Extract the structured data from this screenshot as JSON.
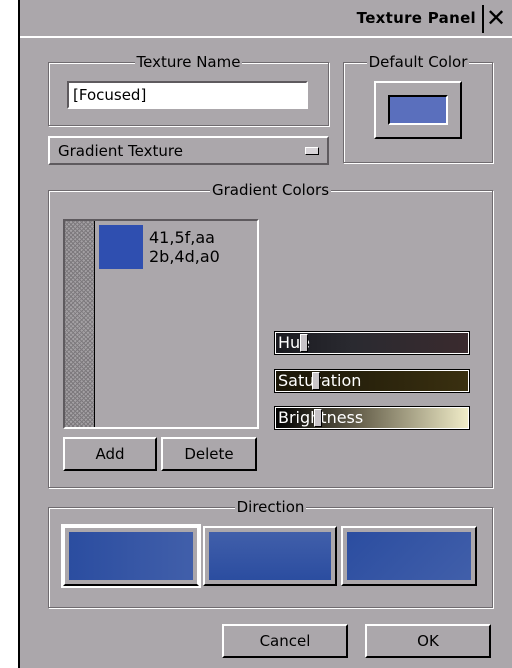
{
  "window": {
    "title": "Texture Panel",
    "close_glyph": "✕"
  },
  "texture_name": {
    "legend": "Texture Name",
    "value": "[Focused]"
  },
  "default_color": {
    "legend": "Default Color",
    "color": "#5a6fbd"
  },
  "texture_type": {
    "selected": "Gradient Texture"
  },
  "gradient_colors": {
    "legend": "Gradient Colors",
    "items": [
      {
        "swatch": "#2f4fb0",
        "line1": "41,5f,aa",
        "line2": "2b,4d,a0"
      }
    ],
    "add_label": "Add",
    "delete_label": "Delete",
    "sliders": {
      "hue": {
        "label": "Hue",
        "value": 0.15
      },
      "saturation": {
        "label": "Saturation",
        "value": 0.2
      },
      "brightness": {
        "label": "Brightness",
        "value": 0.22
      }
    }
  },
  "direction": {
    "legend": "Direction",
    "options": [
      {
        "name": "horizontal",
        "selected": true
      },
      {
        "name": "vertical",
        "selected": false
      },
      {
        "name": "diagonal",
        "selected": false
      }
    ]
  },
  "footer": {
    "cancel_label": "Cancel",
    "ok_label": "OK"
  },
  "colors": {
    "panel_bg": "#aba7ab",
    "gradient_start": "#2b4da0",
    "gradient_end": "#415faa"
  }
}
